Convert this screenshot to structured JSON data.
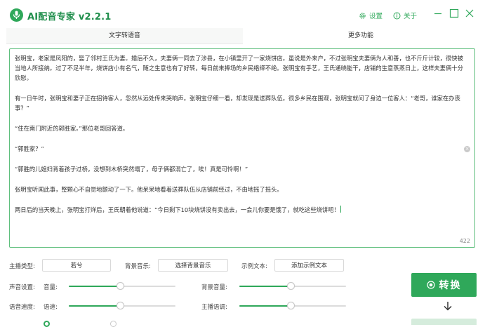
{
  "app": {
    "title": "AI配音专家 v2.2.1",
    "brand_color": "#2fa85a",
    "logo_icon": "microphone-icon"
  },
  "titlebar": {
    "settings_label": "设置",
    "about_label": "关于"
  },
  "tabs": [
    {
      "label": "文字转语音",
      "active": true
    },
    {
      "label": "更多功能",
      "active": false
    }
  ],
  "editor": {
    "paragraphs": [
      "张明宝，老家是凤阳的，娶了邻村王氏为妻。婚后不久，夫妻俩一同去了涉县，在小镇里开了一家烧饼店。虽说是外来户，不过张明宝夫妻俩为人和善，也不斤斤计较，很快被当地人所接纳。过了不足半年，烧饼店小有名气，随之生意也有了好转，每日前来捧场的乡民络绎不绝。张明宝有手艺，王氏通晓能干，店铺的生意蒸蒸日上，这样夫妻俩十分欣慰。",
      "有一日午时，张明宝和妻子正在招待客人，忽然从远处传来哭响声。张明宝仔细一看，却发现是送葬队伍。很多乡民在围观，张明宝就问了身边一位客人：“老哥，谁家在办丧事？”",
      "“住在南门附近的郭胜家。”那位老哥回答道。",
      "“郭胜家？”",
      "“郭胜的儿媳妇背着孩子过桥，没想到木桥突然塌了，母子俩都溺亡了，唉！真是可怜啊！”",
      "张明宝听闻此事，整颗心不自觉地颤动了一下。他呆呆地看着送葬队伍从店铺前经过，不由地摇了摇头。",
      "两日后的当天晚上，张明宝打烊后，王氏朝着他说道：“今日剩下10块烧饼没有卖出去，一会儿你要是饿了，就吃这些烧饼吧！"
    ],
    "char_count": "422"
  },
  "controls": {
    "anchor_type_label": "主播类型:",
    "anchor_value": "若兮",
    "bgm_label": "背景音乐:",
    "bgm_button": "选择背景音乐",
    "sample_label": "示例文本:",
    "sample_button": "添加示例文本",
    "voice_settings_label": "声音设置:",
    "volume_label": "音量:",
    "volume_value": 0.49,
    "bg_volume_label": "背景音量:",
    "bg_volume_value": 0.49,
    "speed_settings_label": "语音速度:",
    "speed_label": "语速:",
    "speed_value": 0.49,
    "tone_label": "主播语调:",
    "tone_value": 0.49,
    "convert_label": "转换"
  },
  "colors": {
    "accent": "#2fa85a",
    "border": "#5fbf7d"
  }
}
